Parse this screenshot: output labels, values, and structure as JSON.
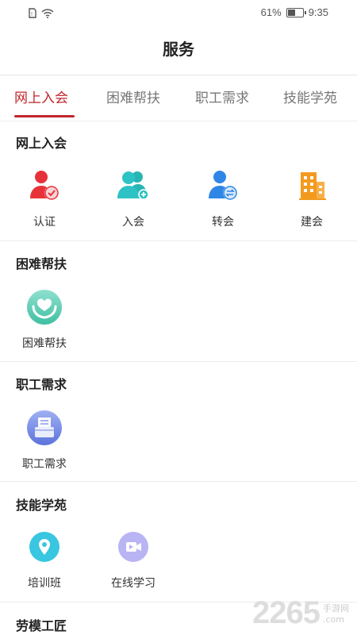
{
  "status_bar": {
    "battery": "61%",
    "battery_level": 0.61,
    "time": "9:35"
  },
  "page": {
    "title": "服务"
  },
  "tabs": [
    {
      "label": "网上入会",
      "active": true
    },
    {
      "label": "困难帮扶",
      "active": false
    },
    {
      "label": "职工需求",
      "active": false
    },
    {
      "label": "技能学苑",
      "active": false
    }
  ],
  "sections": [
    {
      "title": "网上入会",
      "items": [
        {
          "label": "认证",
          "icon": "user-check-icon"
        },
        {
          "label": "入会",
          "icon": "user-add-icon"
        },
        {
          "label": "转会",
          "icon": "user-transfer-icon"
        },
        {
          "label": "建会",
          "icon": "building-icon"
        }
      ]
    },
    {
      "title": "困难帮扶",
      "items": [
        {
          "label": "困难帮扶",
          "icon": "heart-hands-icon"
        }
      ]
    },
    {
      "title": "职工需求",
      "items": [
        {
          "label": "职工需求",
          "icon": "document-box-icon"
        }
      ]
    },
    {
      "title": "技能学苑",
      "items": [
        {
          "label": "培训班",
          "icon": "location-pin-icon"
        },
        {
          "label": "在线学习",
          "icon": "video-icon"
        }
      ]
    },
    {
      "title": "劳模工匠",
      "items": []
    }
  ],
  "colors": {
    "accent": "#c0262b",
    "teal": "#2dc3c4",
    "blue": "#2f86e6",
    "orange": "#f39a1e"
  },
  "watermark": {
    "number": "2265",
    "text1": "手游网",
    "text2": ".com"
  }
}
